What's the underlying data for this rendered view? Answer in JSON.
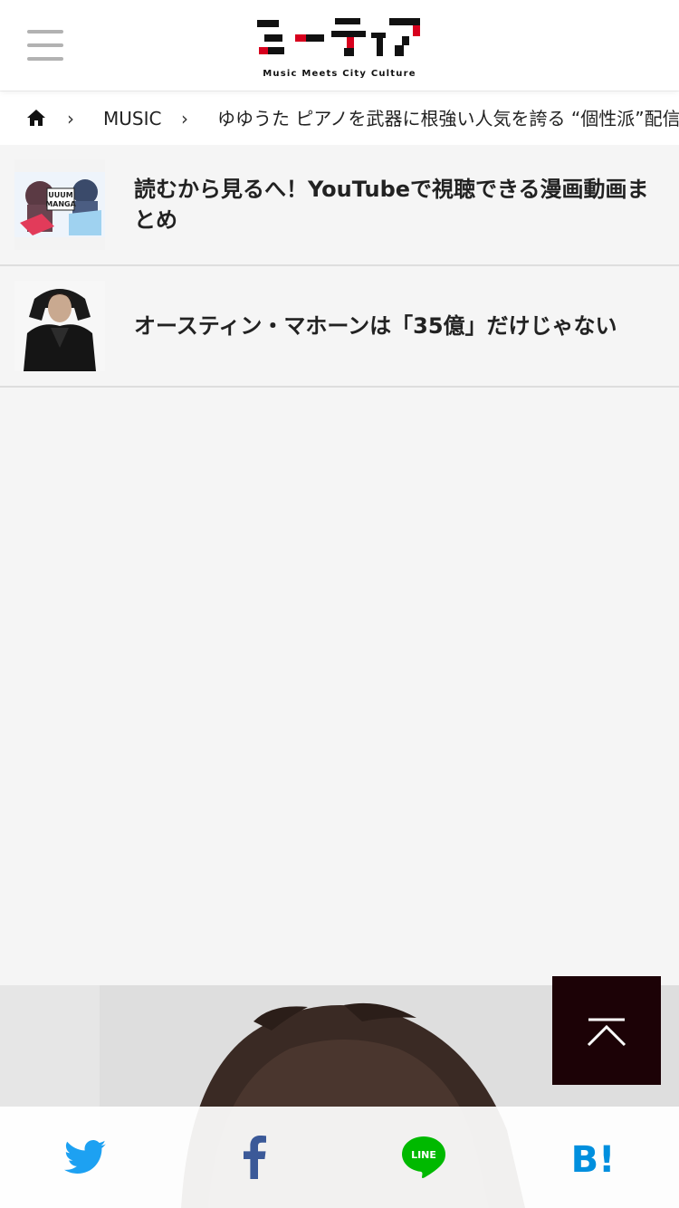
{
  "header": {
    "logo_tagline": "Music Meets City Culture"
  },
  "breadcrumb": {
    "section": "MUSIC",
    "current": "ゆゆうた ピアノを武器に根強い人気を誇る “個性派”配信者"
  },
  "related": [
    {
      "title": "読むから見るへ！YouTubeで視聴できる漫画動画まとめ",
      "thumb_text_1": "UUUM",
      "thumb_text_2": "MANGA"
    },
    {
      "title": "オースティン・マホーンは「35億」だけじゃない"
    }
  ],
  "share": {
    "line_label": "LINE",
    "hatena_label": "B!"
  },
  "colors": {
    "brand_dark": "#1c0206",
    "brand_red": "#d7001d",
    "twitter": "#1da1f2",
    "facebook": "#3b5998",
    "line": "#00b900",
    "hatena": "#008fde"
  }
}
